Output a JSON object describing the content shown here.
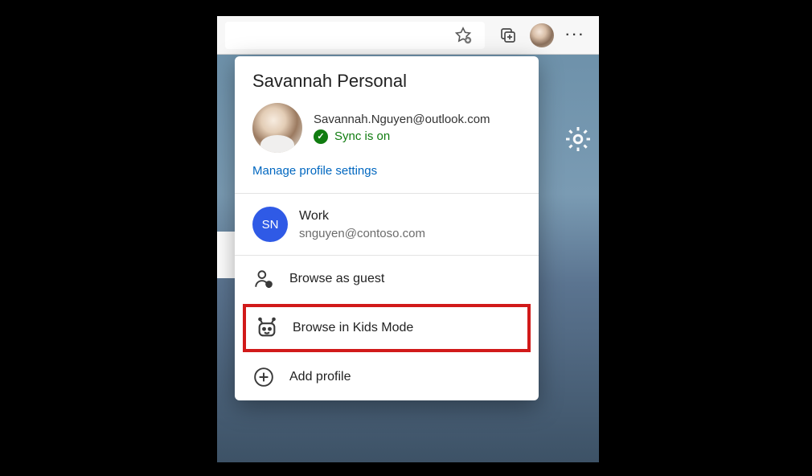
{
  "toolbar": {
    "favorite_tooltip": "Add this page to favorites",
    "collections_tooltip": "Collections",
    "more_label": "···"
  },
  "popup": {
    "title": "Savannah Personal",
    "email": "Savannah.Nguyen@outlook.com",
    "sync_status": "Sync is on",
    "manage_link": "Manage profile settings",
    "work": {
      "initials": "SN",
      "name": "Work",
      "email": "snguyen@contoso.com"
    },
    "actions": {
      "guest": "Browse as guest",
      "kids": "Browse in Kids Mode",
      "add": "Add profile"
    }
  }
}
